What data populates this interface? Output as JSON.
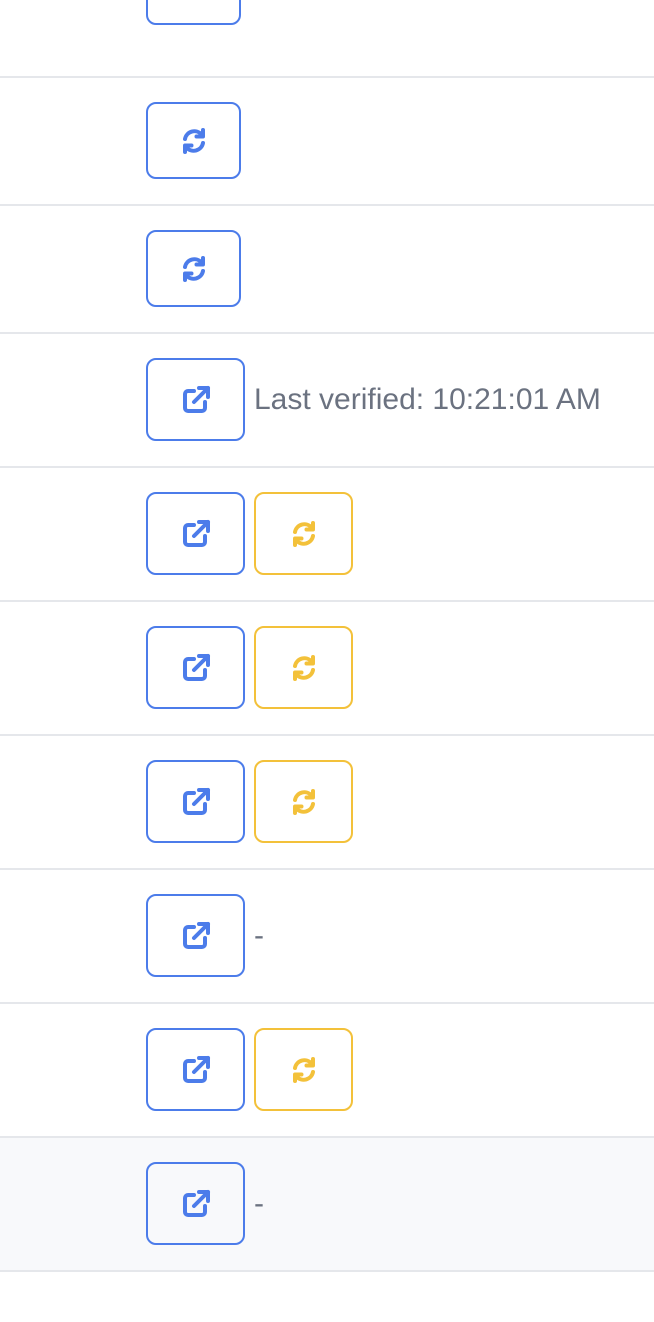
{
  "theme": {
    "primary": "#4c7cea",
    "warning": "#f3c13a",
    "muted_text": "#6b7280",
    "divider": "#e5e7eb",
    "hover_row": "#f8f9fb"
  },
  "rows": [
    {
      "buttons": [
        {
          "icon": "refresh-icon",
          "style": "primary"
        }
      ],
      "status": ""
    },
    {
      "buttons": [
        {
          "icon": "refresh-icon",
          "style": "primary"
        }
      ],
      "status": ""
    },
    {
      "buttons": [
        {
          "icon": "refresh-icon",
          "style": "primary"
        }
      ],
      "status": ""
    },
    {
      "buttons": [
        {
          "icon": "external-link-icon",
          "style": "primary"
        }
      ],
      "status": "Last verified: 10:21:01 AM"
    },
    {
      "buttons": [
        {
          "icon": "external-link-icon",
          "style": "primary"
        },
        {
          "icon": "refresh-icon",
          "style": "warning"
        }
      ],
      "status": ""
    },
    {
      "buttons": [
        {
          "icon": "external-link-icon",
          "style": "primary"
        },
        {
          "icon": "refresh-icon",
          "style": "warning"
        }
      ],
      "status": ""
    },
    {
      "buttons": [
        {
          "icon": "external-link-icon",
          "style": "primary"
        },
        {
          "icon": "refresh-icon",
          "style": "warning"
        }
      ],
      "status": ""
    },
    {
      "buttons": [
        {
          "icon": "external-link-icon",
          "style": "primary"
        }
      ],
      "status": "-"
    },
    {
      "buttons": [
        {
          "icon": "external-link-icon",
          "style": "primary"
        },
        {
          "icon": "refresh-icon",
          "style": "warning"
        }
      ],
      "status": ""
    },
    {
      "buttons": [
        {
          "icon": "external-link-icon",
          "style": "primary"
        }
      ],
      "status": "-",
      "highlighted": true
    }
  ]
}
